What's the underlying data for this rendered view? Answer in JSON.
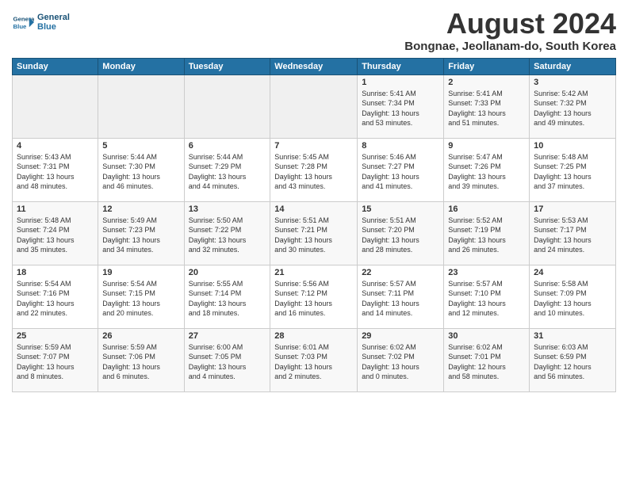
{
  "header": {
    "logo_line1": "General",
    "logo_line2": "Blue",
    "month_title": "August 2024",
    "subtitle": "Bongnae, Jeollanam-do, South Korea"
  },
  "weekdays": [
    "Sunday",
    "Monday",
    "Tuesday",
    "Wednesday",
    "Thursday",
    "Friday",
    "Saturday"
  ],
  "weeks": [
    [
      {
        "day": "",
        "content": ""
      },
      {
        "day": "",
        "content": ""
      },
      {
        "day": "",
        "content": ""
      },
      {
        "day": "",
        "content": ""
      },
      {
        "day": "1",
        "content": "Sunrise: 5:41 AM\nSunset: 7:34 PM\nDaylight: 13 hours\nand 53 minutes."
      },
      {
        "day": "2",
        "content": "Sunrise: 5:41 AM\nSunset: 7:33 PM\nDaylight: 13 hours\nand 51 minutes."
      },
      {
        "day": "3",
        "content": "Sunrise: 5:42 AM\nSunset: 7:32 PM\nDaylight: 13 hours\nand 49 minutes."
      }
    ],
    [
      {
        "day": "4",
        "content": "Sunrise: 5:43 AM\nSunset: 7:31 PM\nDaylight: 13 hours\nand 48 minutes."
      },
      {
        "day": "5",
        "content": "Sunrise: 5:44 AM\nSunset: 7:30 PM\nDaylight: 13 hours\nand 46 minutes."
      },
      {
        "day": "6",
        "content": "Sunrise: 5:44 AM\nSunset: 7:29 PM\nDaylight: 13 hours\nand 44 minutes."
      },
      {
        "day": "7",
        "content": "Sunrise: 5:45 AM\nSunset: 7:28 PM\nDaylight: 13 hours\nand 43 minutes."
      },
      {
        "day": "8",
        "content": "Sunrise: 5:46 AM\nSunset: 7:27 PM\nDaylight: 13 hours\nand 41 minutes."
      },
      {
        "day": "9",
        "content": "Sunrise: 5:47 AM\nSunset: 7:26 PM\nDaylight: 13 hours\nand 39 minutes."
      },
      {
        "day": "10",
        "content": "Sunrise: 5:48 AM\nSunset: 7:25 PM\nDaylight: 13 hours\nand 37 minutes."
      }
    ],
    [
      {
        "day": "11",
        "content": "Sunrise: 5:48 AM\nSunset: 7:24 PM\nDaylight: 13 hours\nand 35 minutes."
      },
      {
        "day": "12",
        "content": "Sunrise: 5:49 AM\nSunset: 7:23 PM\nDaylight: 13 hours\nand 34 minutes."
      },
      {
        "day": "13",
        "content": "Sunrise: 5:50 AM\nSunset: 7:22 PM\nDaylight: 13 hours\nand 32 minutes."
      },
      {
        "day": "14",
        "content": "Sunrise: 5:51 AM\nSunset: 7:21 PM\nDaylight: 13 hours\nand 30 minutes."
      },
      {
        "day": "15",
        "content": "Sunrise: 5:51 AM\nSunset: 7:20 PM\nDaylight: 13 hours\nand 28 minutes."
      },
      {
        "day": "16",
        "content": "Sunrise: 5:52 AM\nSunset: 7:19 PM\nDaylight: 13 hours\nand 26 minutes."
      },
      {
        "day": "17",
        "content": "Sunrise: 5:53 AM\nSunset: 7:17 PM\nDaylight: 13 hours\nand 24 minutes."
      }
    ],
    [
      {
        "day": "18",
        "content": "Sunrise: 5:54 AM\nSunset: 7:16 PM\nDaylight: 13 hours\nand 22 minutes."
      },
      {
        "day": "19",
        "content": "Sunrise: 5:54 AM\nSunset: 7:15 PM\nDaylight: 13 hours\nand 20 minutes."
      },
      {
        "day": "20",
        "content": "Sunrise: 5:55 AM\nSunset: 7:14 PM\nDaylight: 13 hours\nand 18 minutes."
      },
      {
        "day": "21",
        "content": "Sunrise: 5:56 AM\nSunset: 7:12 PM\nDaylight: 13 hours\nand 16 minutes."
      },
      {
        "day": "22",
        "content": "Sunrise: 5:57 AM\nSunset: 7:11 PM\nDaylight: 13 hours\nand 14 minutes."
      },
      {
        "day": "23",
        "content": "Sunrise: 5:57 AM\nSunset: 7:10 PM\nDaylight: 13 hours\nand 12 minutes."
      },
      {
        "day": "24",
        "content": "Sunrise: 5:58 AM\nSunset: 7:09 PM\nDaylight: 13 hours\nand 10 minutes."
      }
    ],
    [
      {
        "day": "25",
        "content": "Sunrise: 5:59 AM\nSunset: 7:07 PM\nDaylight: 13 hours\nand 8 minutes."
      },
      {
        "day": "26",
        "content": "Sunrise: 5:59 AM\nSunset: 7:06 PM\nDaylight: 13 hours\nand 6 minutes."
      },
      {
        "day": "27",
        "content": "Sunrise: 6:00 AM\nSunset: 7:05 PM\nDaylight: 13 hours\nand 4 minutes."
      },
      {
        "day": "28",
        "content": "Sunrise: 6:01 AM\nSunset: 7:03 PM\nDaylight: 13 hours\nand 2 minutes."
      },
      {
        "day": "29",
        "content": "Sunrise: 6:02 AM\nSunset: 7:02 PM\nDaylight: 13 hours\nand 0 minutes."
      },
      {
        "day": "30",
        "content": "Sunrise: 6:02 AM\nSunset: 7:01 PM\nDaylight: 12 hours\nand 58 minutes."
      },
      {
        "day": "31",
        "content": "Sunrise: 6:03 AM\nSunset: 6:59 PM\nDaylight: 12 hours\nand 56 minutes."
      }
    ]
  ]
}
